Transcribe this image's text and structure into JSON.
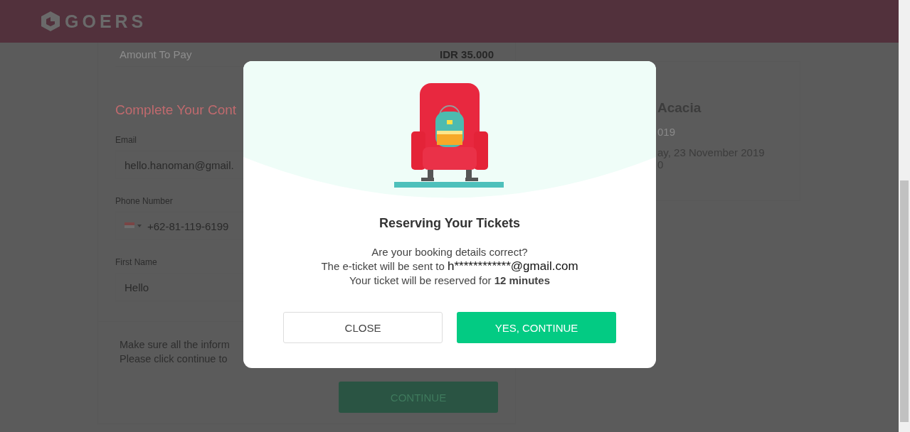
{
  "header": {
    "logo": "GOERS"
  },
  "order": {
    "amount_label": "Amount To Pay",
    "amount": "IDR 35.000"
  },
  "contact": {
    "heading": "Complete Your Cont",
    "fields": [
      {
        "kind": "text",
        "label": "Email",
        "value": "hello.hanoman@gmail."
      },
      {
        "kind": "phone",
        "label": "Phone Number",
        "value": "+62-81-119-6199"
      },
      {
        "kind": "text",
        "label": "First Name",
        "value": "Hello"
      }
    ]
  },
  "notice": {
    "lines": [
      "Make sure all the inform",
      "Please click continue to"
    ],
    "button": "CONTINUE"
  },
  "event": {
    "title": "Acacia",
    "year": "019",
    "date": "ay, 23 November 2019",
    "time": "0"
  },
  "modal": {
    "title": "Reserving Your Tickets",
    "question": "Are your booking details correct?",
    "sent_to": "The e-ticket will be sent to",
    "email": "h************@gmail.com",
    "reserve": "Your ticket will be reserved for **12 minutes**",
    "buttons": [
      {
        "kind": "secondary",
        "label": "CLOSE"
      },
      {
        "kind": "primary",
        "label": "YES, CONTINUE"
      }
    ]
  }
}
